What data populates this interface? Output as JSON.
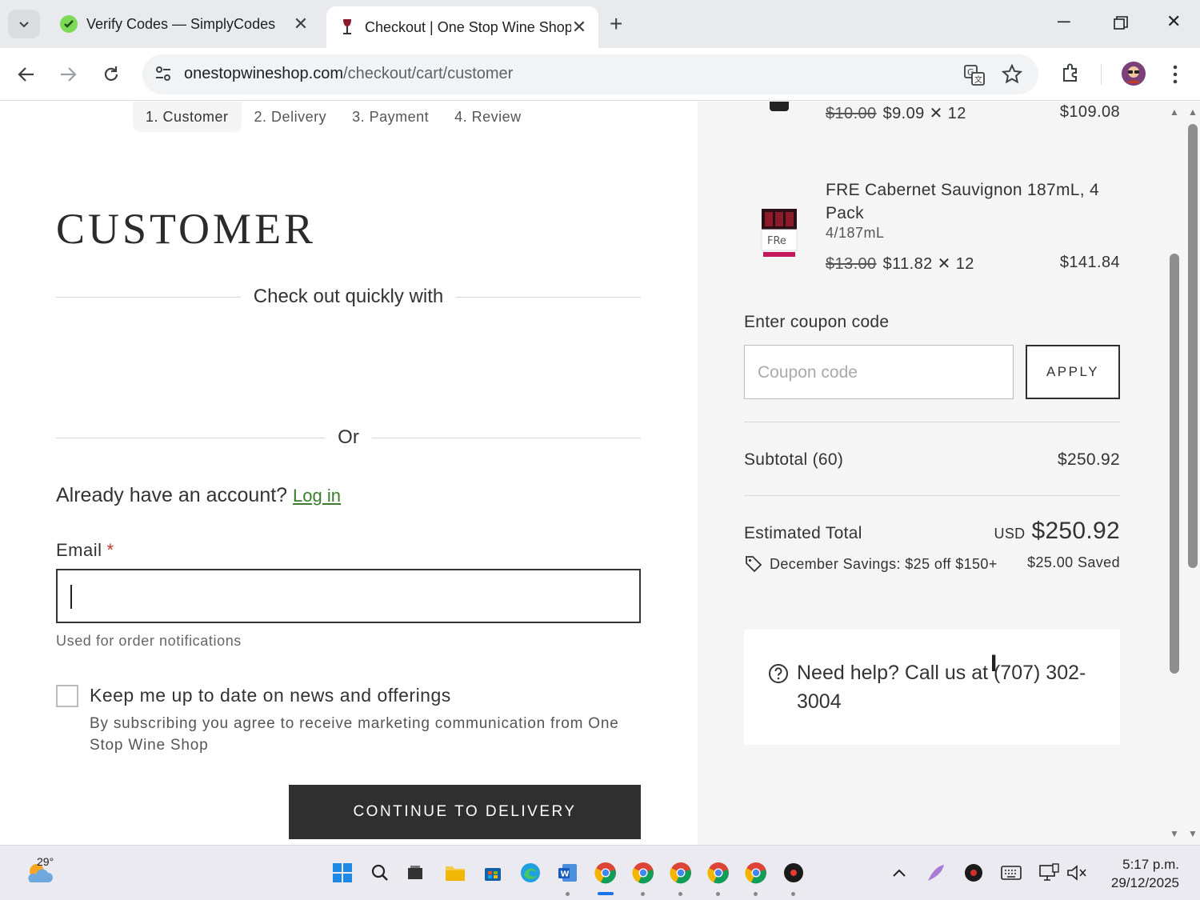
{
  "browser": {
    "tabs": [
      {
        "title": "Verify Codes — SimplyCodes",
        "active": false
      },
      {
        "title": "Checkout | One Stop Wine Shop",
        "active": true
      }
    ],
    "url_host": "onestopwineshop.com",
    "url_path": "/checkout/cart/customer"
  },
  "steps": [
    "1. Customer",
    "2. Delivery",
    "3. Payment",
    "4. Review"
  ],
  "customer": {
    "heading": "CUSTOMER",
    "quick_checkout": "Check out quickly with",
    "or": "Or",
    "have_account": "Already have an account?",
    "login_link": "Log in",
    "email_label": "Email",
    "required_mark": "*",
    "email_hint": "Used for order notifications",
    "newsletter_label": "Keep me up to date on news and offerings",
    "newsletter_sub": "By subscribing you agree to receive marketing communication from One Stop Wine Shop",
    "continue_button": "CONTINUE TO DELIVERY"
  },
  "summary": {
    "items": [
      {
        "name": "",
        "size": "",
        "original_price": "$10.00",
        "price": "$9.09",
        "qty": "12",
        "total": "$109.08"
      },
      {
        "name": "FRE Cabernet Sauvignon 187mL, 4 Pack",
        "size": "4/187mL",
        "original_price": "$13.00",
        "price": "$11.82",
        "qty": "12",
        "total": "$141.84"
      }
    ],
    "qty_symbol": "✕",
    "coupon_label": "Enter coupon code",
    "coupon_placeholder": "Coupon code",
    "apply_button": "APPLY",
    "subtotal_label": "Subtotal (60)",
    "subtotal_value": "$250.92",
    "estimated_total_label": "Estimated Total",
    "currency": "USD",
    "estimated_total_value": "$250.92",
    "promo_label": "December Savings: $25 off $150+",
    "promo_saved": "$25.00 Saved",
    "help_text": "Need help? Call us at (707) 302-3004"
  },
  "taskbar": {
    "temperature": "29°",
    "time": "5:17 p.m.",
    "date": "29/12/2025"
  },
  "colors": {
    "link_green": "#3a7d2c",
    "button_dark": "#2f2f2f",
    "summary_bg": "#f5f5f5",
    "required_red": "#c0392b"
  }
}
